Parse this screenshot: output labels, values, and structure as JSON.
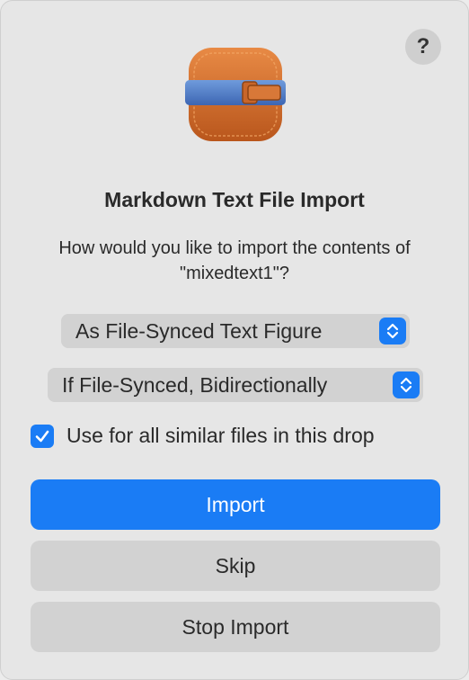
{
  "dialog": {
    "help_label": "?",
    "app_icon": "scrivener-style-book-icon",
    "title": "Markdown Text File Import",
    "message": "How would you like to import the contents of \"mixedtext1\"?",
    "import_as": {
      "selected": "As File-Synced Text Figure",
      "icon": "up-down-chevron-icon"
    },
    "sync_mode": {
      "selected": "If File-Synced, Bidirectionally",
      "icon": "up-down-chevron-icon"
    },
    "apply_all": {
      "label": "Use for all similar files in this drop",
      "checked": true
    },
    "buttons": {
      "import": "Import",
      "skip": "Skip",
      "stop": "Stop Import"
    },
    "colors": {
      "accent": "#1a7cf5",
      "background": "#e6e6e6",
      "secondary_button": "#d2d2d2"
    }
  }
}
